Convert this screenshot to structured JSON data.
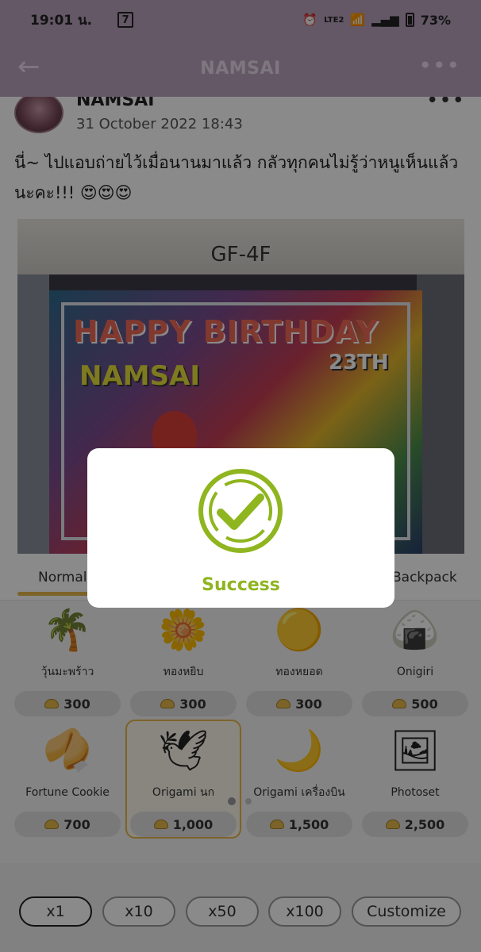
{
  "status_bar": {
    "time": "19:01 น.",
    "carrier_icon": "7",
    "network": "LTE2",
    "battery": "73%"
  },
  "nav": {
    "title": "NAMSAI",
    "back_icon": "←",
    "more_icon": "•••"
  },
  "post": {
    "author": "NAMSAI",
    "date": "31 October 2022 18:43",
    "text": "นี่~ ไปแอบถ่ายไว้เมื่อนานมาแล้ว กลัวทุกคนไม่รู้ว่าหนูเห็นแล้วนะคะ!!! 😍😍😍",
    "more_icon": "•••",
    "photo": {
      "floor_sign": "GF-4F",
      "banner": "HAPPY BIRTHDAY",
      "age": "23TH",
      "name": "NAMSAI"
    }
  },
  "tabs": [
    "Normal",
    "Backpack"
  ],
  "gifts": [
    {
      "name": "วุ้นมะพร้าว",
      "price": "300",
      "icon": "palm-tree-icon",
      "glyph": "🌴"
    },
    {
      "name": "ทองหยิบ",
      "price": "300",
      "icon": "golden-flower-dessert-icon",
      "glyph": "🌼"
    },
    {
      "name": "ทองหยอด",
      "price": "300",
      "icon": "golden-drops-icon",
      "glyph": "🟡"
    },
    {
      "name": "Onigiri",
      "price": "500",
      "icon": "onigiri-icon",
      "glyph": "🍙"
    },
    {
      "name": "Fortune Cookie",
      "price": "700",
      "icon": "fortune-cookie-icon",
      "glyph": "🥠"
    },
    {
      "name": "Origami นก",
      "price": "1,000",
      "icon": "origami-crane-icon",
      "glyph": "🕊"
    },
    {
      "name": "Origami เครื่องบิน",
      "price": "1,500",
      "icon": "origami-plane-icon",
      "glyph": "🌙"
    },
    {
      "name": "Photoset",
      "price": "2,500",
      "icon": "photoset-icon",
      "glyph": "🖼"
    }
  ],
  "selected_gift": "Origami นก",
  "pager": {
    "pages": 2,
    "current": 1
  },
  "quantity": {
    "options": [
      "x1",
      "x10",
      "x50",
      "x100",
      "Customize"
    ],
    "selected": "x1"
  },
  "modal": {
    "label": "Success",
    "icon": "check-circle-icon",
    "color": "#8fb51f"
  }
}
